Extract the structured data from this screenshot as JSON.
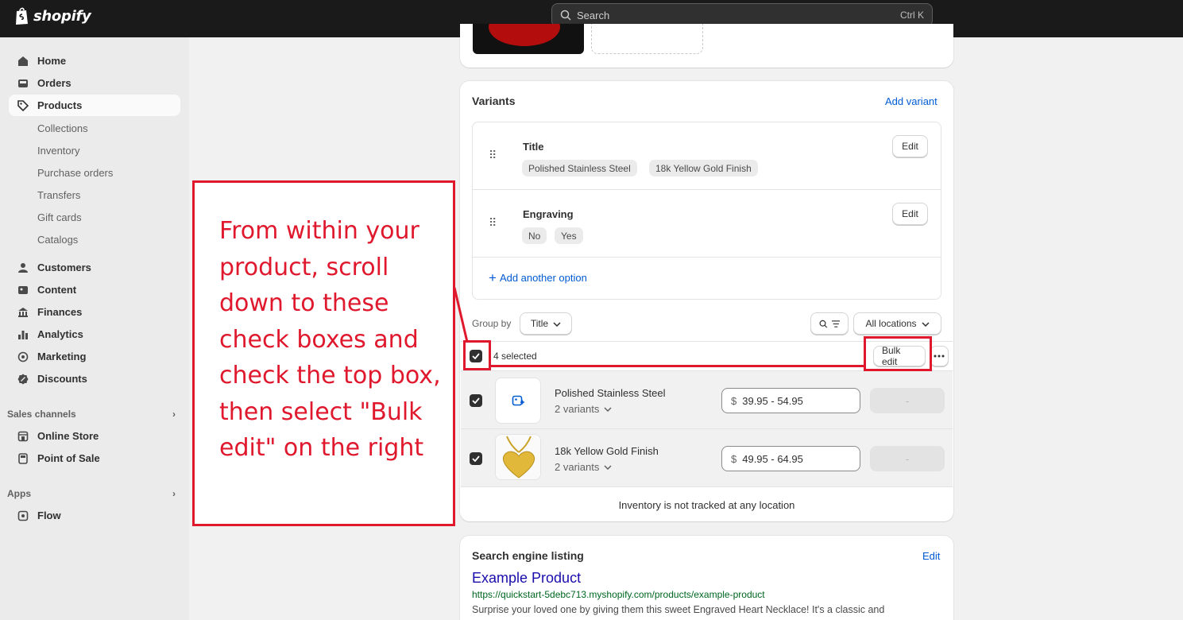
{
  "topbar": {
    "brand": "shopify",
    "search_placeholder": "Search",
    "search_shortcut": "Ctrl K"
  },
  "sidebar": {
    "main": [
      {
        "label": "Home",
        "icon": "home-icon"
      },
      {
        "label": "Orders",
        "icon": "inbox-icon"
      },
      {
        "label": "Products",
        "icon": "tag-icon",
        "active": true
      }
    ],
    "products_sub": [
      "Collections",
      "Inventory",
      "Purchase orders",
      "Transfers",
      "Gift cards",
      "Catalogs"
    ],
    "main2": [
      {
        "label": "Customers",
        "icon": "person-icon"
      },
      {
        "label": "Content",
        "icon": "content-icon"
      },
      {
        "label": "Finances",
        "icon": "bank-icon"
      },
      {
        "label": "Analytics",
        "icon": "bar-chart-icon"
      },
      {
        "label": "Marketing",
        "icon": "target-icon"
      },
      {
        "label": "Discounts",
        "icon": "discount-icon"
      }
    ],
    "sales_channels_title": "Sales channels",
    "sales_channels": [
      {
        "label": "Online Store",
        "icon": "store-icon"
      },
      {
        "label": "Point of Sale",
        "icon": "pos-icon"
      }
    ],
    "apps_title": "Apps",
    "apps": [
      {
        "label": "Flow",
        "icon": "flow-icon"
      }
    ]
  },
  "variants": {
    "title": "Variants",
    "add_variant": "Add variant",
    "options": [
      {
        "name": "Title",
        "values": [
          "Polished Stainless Steel",
          "18k Yellow Gold Finish"
        ],
        "edit": "Edit"
      },
      {
        "name": "Engraving",
        "values": [
          "No",
          "Yes"
        ],
        "edit": "Edit"
      }
    ],
    "add_option": "Add another option",
    "group_by_label": "Group by",
    "group_by_value": "Title",
    "locations": "All locations",
    "selected_text": "4 selected",
    "bulk_edit": "Bulk edit",
    "rows": [
      {
        "name": "Polished Stainless Steel",
        "count": "2 variants",
        "currency": "$",
        "price": "39.95 - 54.95",
        "qty": "-"
      },
      {
        "name": "18k Yellow Gold Finish",
        "count": "2 variants",
        "currency": "$",
        "price": "49.95 - 64.95",
        "qty": "-"
      }
    ],
    "inventory_note": "Inventory is not tracked at any location"
  },
  "seo": {
    "title": "Search engine listing",
    "edit": "Edit",
    "page_title": "Example Product",
    "url": "https://quickstart-5debc713.myshopify.com/products/example-product",
    "description": "Surprise your loved one by giving them this sweet Engraved Heart Necklace! It's a classic and"
  },
  "annotation": {
    "text": "From within your product, scroll down to these check boxes and check the top box, then select \"Bulk edit\" on the right",
    "color": "#e0182d"
  }
}
